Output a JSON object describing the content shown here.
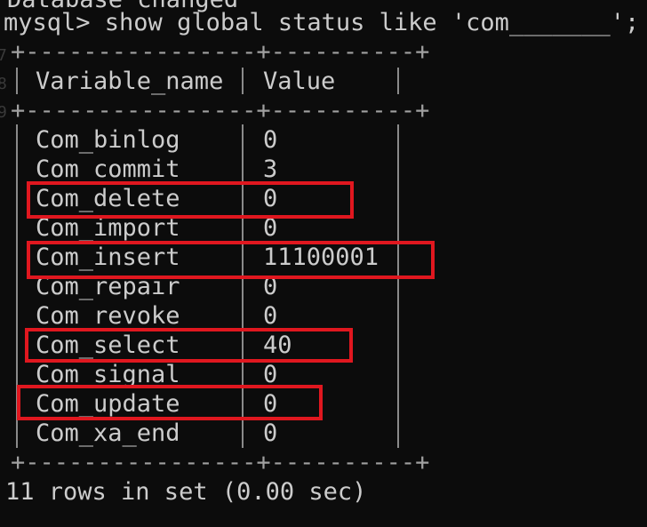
{
  "terminal": {
    "previous_line": "Database changed",
    "command": "mysql> show global status like 'com_______';",
    "border": "+----------------+----------+",
    "header": {
      "col1": "Variable_name",
      "col2": "Value"
    },
    "rows": [
      {
        "name": "Com_binlog",
        "value": "0"
      },
      {
        "name": "Com_commit",
        "value": "3"
      },
      {
        "name": "Com_delete",
        "value": "0"
      },
      {
        "name": "Com_import",
        "value": "0"
      },
      {
        "name": "Com_insert",
        "value": "11100001"
      },
      {
        "name": "Com_repair",
        "value": "0"
      },
      {
        "name": "Com_revoke",
        "value": "0"
      },
      {
        "name": "Com_select",
        "value": "40"
      },
      {
        "name": "Com_signal",
        "value": "0"
      },
      {
        "name": "Com_update",
        "value": "0"
      },
      {
        "name": "Com_xa_end",
        "value": "0"
      }
    ],
    "footer": "11 rows in set (0.00 sec)",
    "highlighted_rows": [
      "Com_delete",
      "Com_insert",
      "Com_select",
      "Com_update"
    ],
    "colors": {
      "background": "#0c0c0c",
      "text": "#cccccc",
      "highlight": "#e0171f"
    }
  }
}
